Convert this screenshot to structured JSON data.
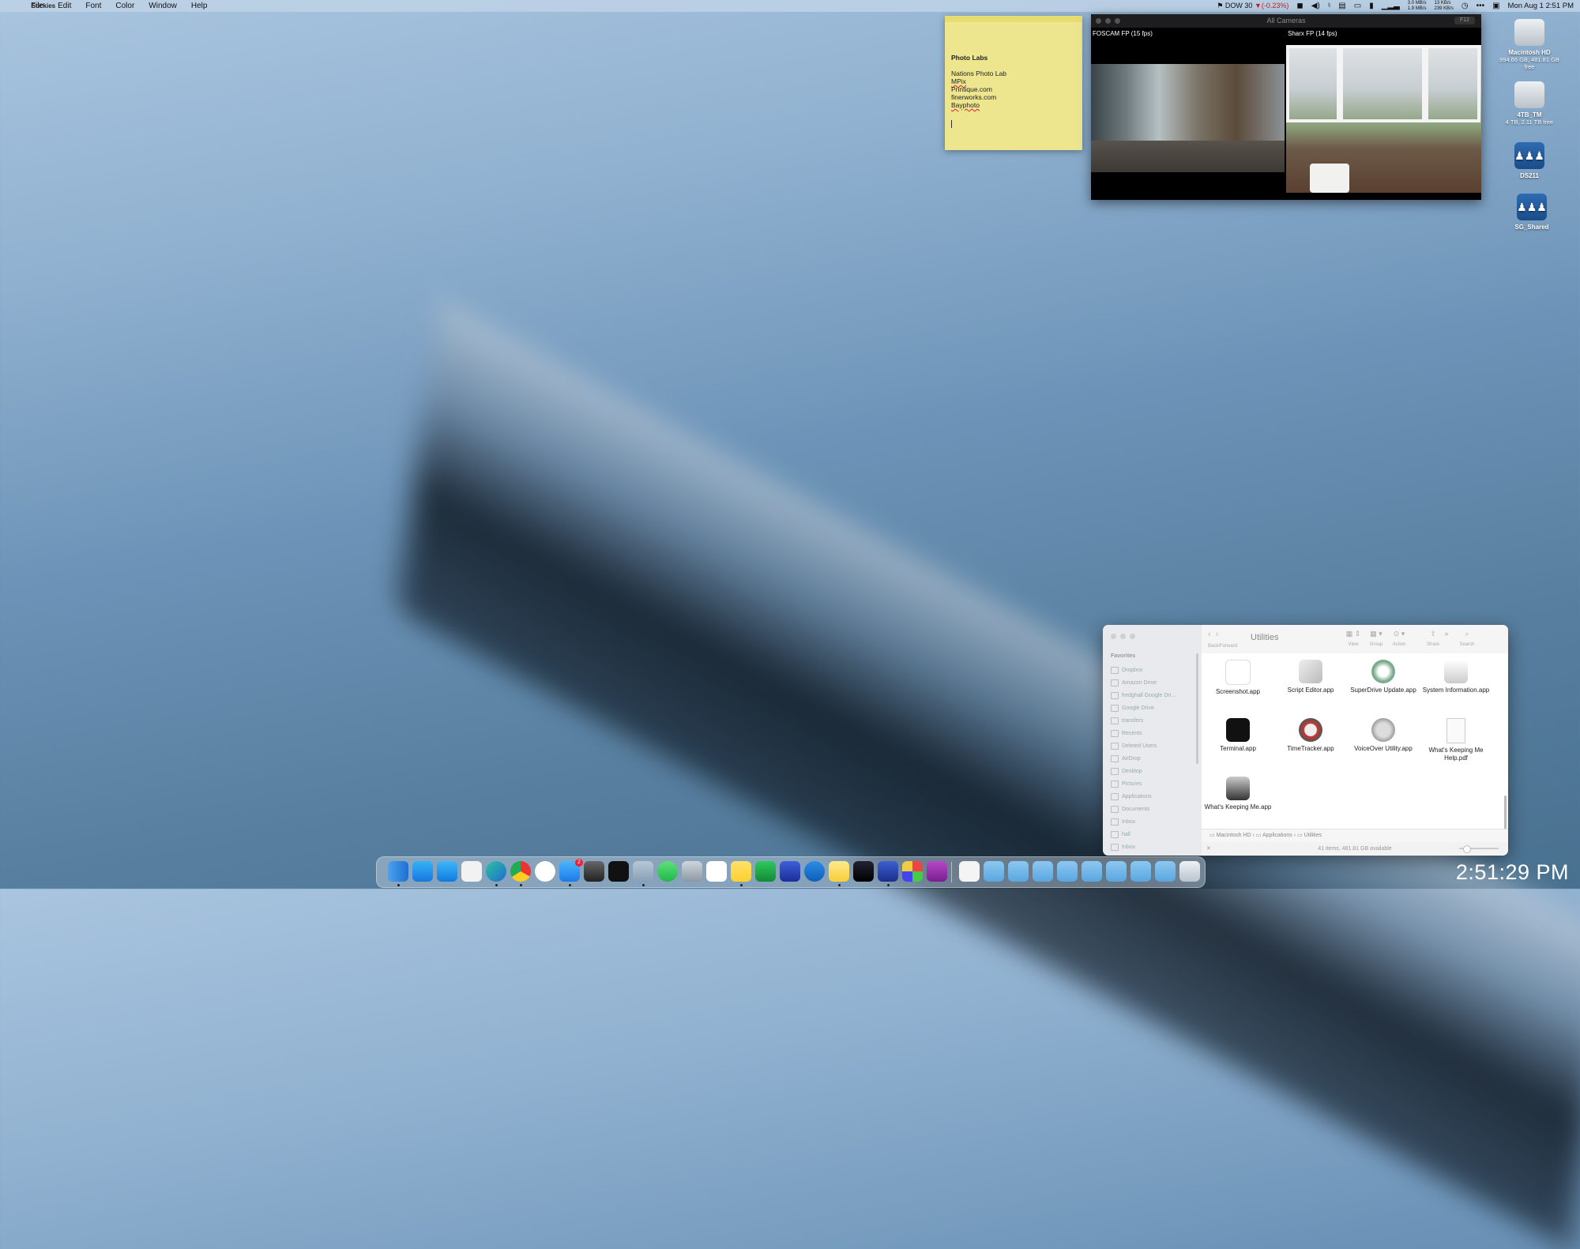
{
  "menubar": {
    "app_name": "Stickies",
    "menus": [
      "File",
      "Edit",
      "Font",
      "Color",
      "Window",
      "Help"
    ],
    "stock": {
      "label": "DOW 30",
      "change": "▼(-0.23%)"
    },
    "net_up": "3.0 MB/s",
    "net_down": "1.9 MB/s",
    "disk_read": "13 KB/s",
    "disk_write": "239 KB/s",
    "datetime": "Mon Aug 1  2:51 PM"
  },
  "sticky": {
    "title": "Photo Labs",
    "lines": [
      "Nations Photo Lab",
      "MPix",
      "Printique.com",
      "finerworks.com",
      "Bayphoto"
    ]
  },
  "camera_window": {
    "title": "All Cameras",
    "badge": "F12",
    "cam1_label": "FOSCAM FP (15 fps)",
    "cam2_label": "Sharx FP (14 fps)"
  },
  "desktop_icons": [
    {
      "name": "Macintosh HD",
      "sub": "994.66 GB, 481.81 GB free"
    },
    {
      "name": "4TB_TM",
      "sub": "4 TB, 2.11 TB free"
    },
    {
      "name": "DS211",
      "sub": ""
    },
    {
      "name": "SG_Shared",
      "sub": ""
    }
  ],
  "finder": {
    "title": "Utilities",
    "nav_label": "Back/Forward",
    "tools": [
      "View",
      "Group",
      "Action",
      "Share",
      "Search"
    ],
    "sidebar_heading": "Favorites",
    "sidebar_items": [
      "Dropbox",
      "Amazon Drive",
      "fredghall Google Dri...",
      "Google Drive",
      "transfers",
      "Recents",
      "Deleted Users",
      "AirDrop",
      "Desktop",
      "Pictures",
      "Applications",
      "Documents",
      "Inbox",
      "hall",
      "Inbox"
    ],
    "apps": [
      {
        "label": "Screenshot.app"
      },
      {
        "label": "Script Editor.app"
      },
      {
        "label": "SuperDrive Update.app"
      },
      {
        "label": "System Information.app"
      },
      {
        "label": "Terminal.app"
      },
      {
        "label": "TimeTracker.app"
      },
      {
        "label": "VoiceOver Utility.app"
      },
      {
        "label": "What's Keeping Me Help.pdf"
      },
      {
        "label": "What's Keeping Me.app"
      }
    ],
    "path": [
      "Macintosh HD",
      "Applications",
      "Utilities"
    ],
    "status": "41 items, 481.81 GB available"
  },
  "dock": {
    "mail_badge": "2"
  },
  "clock_overlay": "2:51:29 PM"
}
